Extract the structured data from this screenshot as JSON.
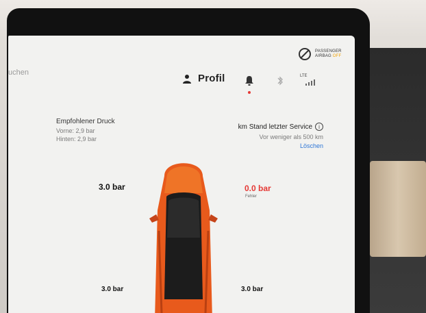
{
  "topbar": {
    "airbag": {
      "line1": "PASSENGER",
      "line2": "AIRBAG",
      "status": "OFF"
    },
    "search_hint": "uchen",
    "profile_label": "Profil",
    "network_label": "LTE"
  },
  "tires": {
    "recommended_title": "Empfohlener Druck",
    "front": "Vorne: 2,9 bar",
    "rear": "Hinten: 2,9 bar",
    "front_left": "3.0 bar",
    "front_right": "0.0 bar",
    "front_right_status": "Fehler",
    "rear_left": "3.0 bar",
    "rear_right": "3.0 bar"
  },
  "service": {
    "title": "km Stand letzter Service",
    "info": "i",
    "subtitle": "Vor weniger als 500 km",
    "reset_label": "Löschen"
  },
  "colors": {
    "accent_red": "#e53935",
    "link_blue": "#2e76d6",
    "car_orange": "#e85a1c"
  }
}
